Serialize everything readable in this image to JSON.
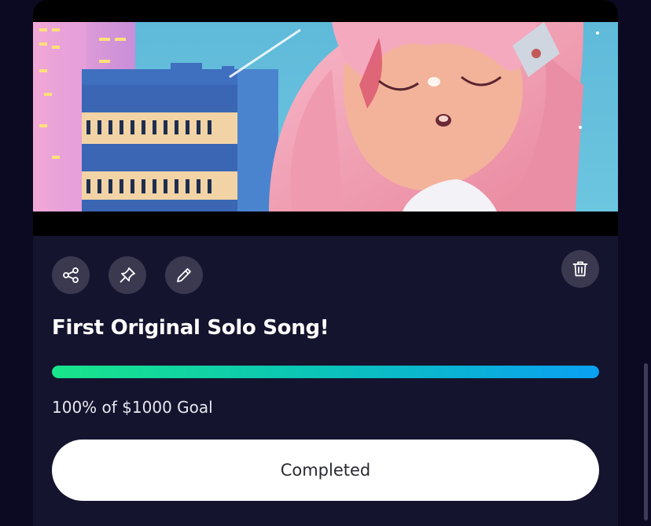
{
  "goal": {
    "title": "First Original Solo Song!",
    "progress_percent": 100,
    "progress_text": "100% of $1000 Goal",
    "status_button_label": "Completed"
  },
  "actions": {
    "share_icon": "share-icon",
    "pin_icon": "pin-icon",
    "edit_icon": "pencil-icon",
    "delete_icon": "trash-icon"
  },
  "colors": {
    "page_bg": "#0b0a22",
    "card_bg": "#15142f",
    "icon_button_bg": "#3a3950",
    "progress_gradient_start": "#19e58a",
    "progress_gradient_end": "#0aa0f2",
    "button_bg": "#ffffff"
  }
}
